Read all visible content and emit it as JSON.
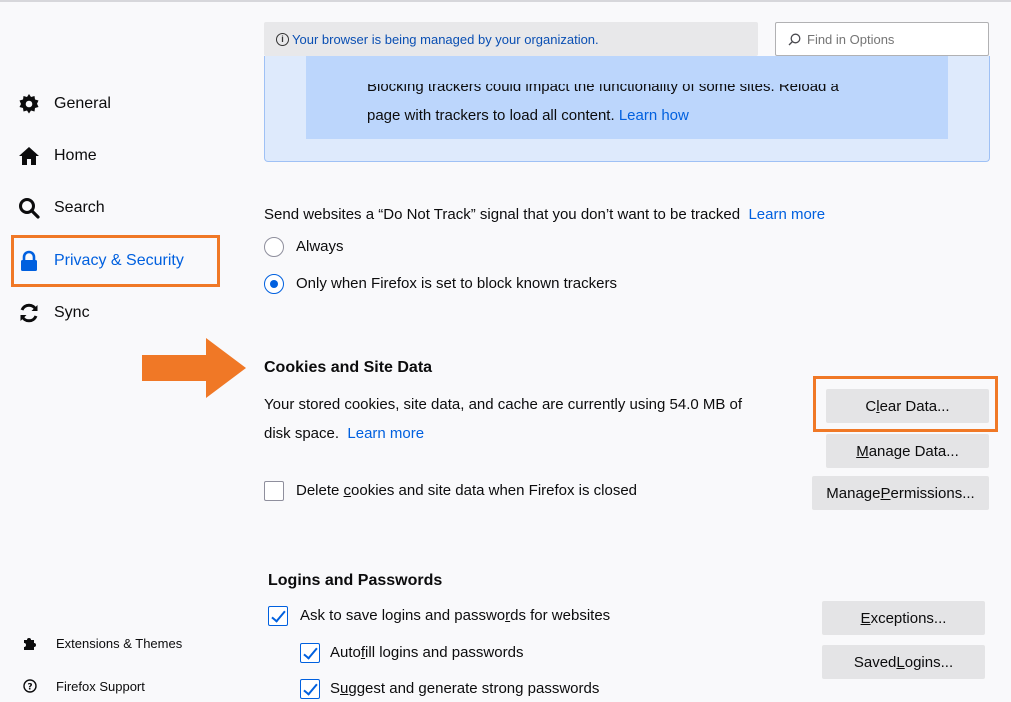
{
  "header": {
    "managed_notice": "Your browser is being managed by your organization.",
    "search_placeholder": "Find in Options"
  },
  "sidebar": {
    "items": [
      {
        "label": "General",
        "icon": "gear-icon"
      },
      {
        "label": "Home",
        "icon": "home-icon"
      },
      {
        "label": "Search",
        "icon": "search-icon"
      },
      {
        "label": "Privacy & Security",
        "icon": "lock-icon",
        "active": true
      },
      {
        "label": "Sync",
        "icon": "sync-icon"
      }
    ],
    "footer": [
      {
        "label": "Extensions & Themes",
        "icon": "puzzle-icon"
      },
      {
        "label": "Firefox Support",
        "icon": "help-icon"
      }
    ]
  },
  "tracker_panel": {
    "cut_text": "Blocking trackers could impact the functionality of some sites. Reload a",
    "text": "page with trackers to load all content.",
    "link": "Learn how"
  },
  "dnt": {
    "label": "Send websites a “Do Not Track” signal that you don’t want to be tracked",
    "link": "Learn more",
    "options": [
      {
        "label": "Always",
        "selected": false
      },
      {
        "label": "Only when Firefox is set to block known trackers",
        "selected": true
      }
    ]
  },
  "cookies": {
    "heading": "Cookies and Site Data",
    "usage_text": "Your stored cookies, site data, and cache are currently using 54.0 MB of",
    "usage_text2": "disk space.",
    "link": "Learn more",
    "delete_on_close": {
      "pre": "Delete ",
      "ul": "c",
      "post": "ookies and site data when Firefox is closed",
      "checked": false
    },
    "buttons": {
      "clear": {
        "pre": "C",
        "ul": "l",
        "post": "ear Data..."
      },
      "manage": {
        "pre": "",
        "ul": "M",
        "post": "anage Data..."
      },
      "permissions": {
        "pre": "Manage ",
        "ul": "P",
        "post": "ermissions..."
      }
    }
  },
  "logins": {
    "heading": "Logins and Passwords",
    "ask_save": {
      "pre": "Ask to save logins and passwo",
      "ul": "r",
      "post": "ds for websites",
      "checked": true
    },
    "autofill": {
      "pre": "Auto",
      "ul": "f",
      "post": "ill logins and passwords",
      "checked": true
    },
    "suggest": {
      "pre": "S",
      "ul": "u",
      "post": "ggest and generate strong passwords",
      "checked": true
    },
    "buttons": {
      "exceptions": {
        "pre": "",
        "ul": "E",
        "post": "xceptions..."
      },
      "saved": {
        "pre": "Saved ",
        "ul": "L",
        "post": "ogins..."
      }
    }
  },
  "colors": {
    "accent": "#0060df",
    "highlight": "#f07826"
  }
}
